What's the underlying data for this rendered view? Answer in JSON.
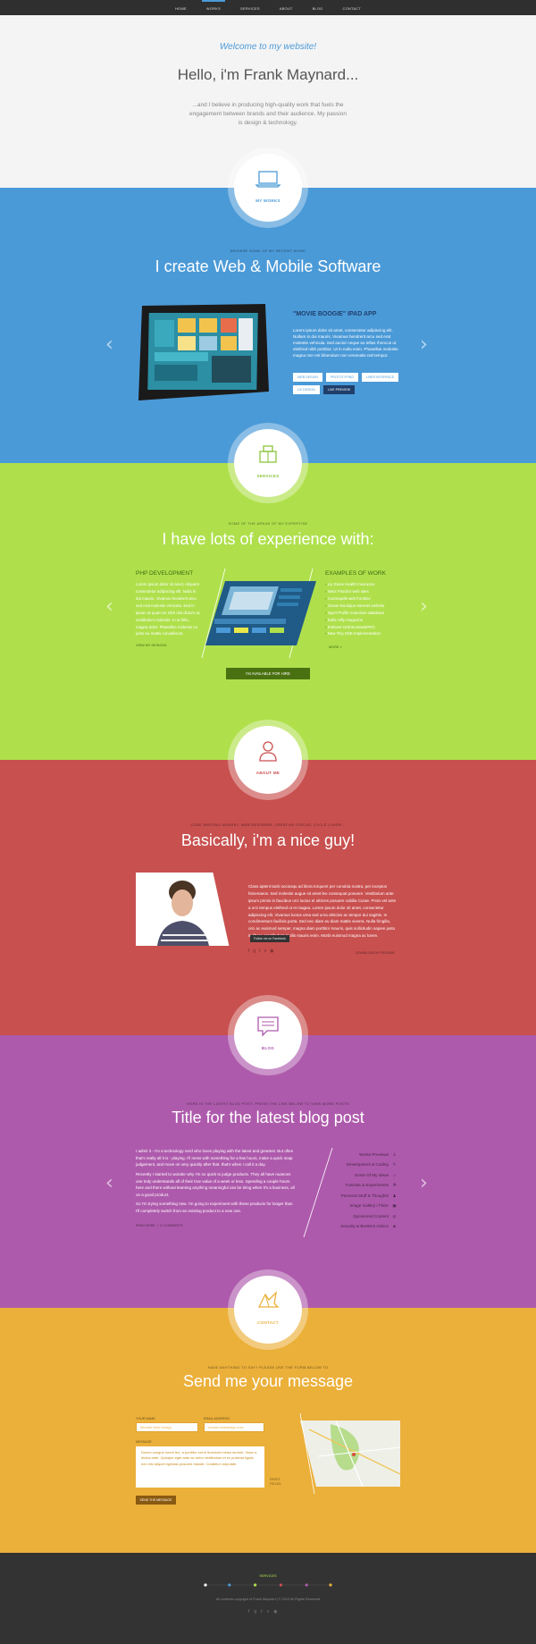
{
  "nav": {
    "items": [
      "HOME",
      "WORKS",
      "SERVICES",
      "ABOUT",
      "BLOG",
      "CONTACT"
    ],
    "active": "WORKS"
  },
  "hero": {
    "welcome": "Welcome to my website!",
    "hello": "Hello, i'm Frank Maynard...",
    "intro": "...and I believe in producing high-quality work that fuels the engagement between brands and their audience. My passion is design & technology."
  },
  "works": {
    "badge": "MY WORKS",
    "kicker": "BROWSE SOME OF MY RECENT WORK",
    "title": "I create Web & Mobile Software",
    "project_title": "\"MOVIE BOOGIE\" IPAD APP",
    "project_text": "Lorem ipsum dolor sit amet, consectetur adipiscing elit. Nullam in dui mauris. Vivamus hendrerit arcu sed erat molestie vehicula. Sed auctor neque eu tellus rhoncus ut eleifend nibh porttitor. Ut in nulla enim. Phasellus molestie magna non est bibendum non venenatis nisl tempor.",
    "tags": [
      "WEB DESIGN",
      "PROTOTYPING",
      "USER INTERFACE",
      "UX DESIGN"
    ],
    "live_preview": "LIVE PREVIEW"
  },
  "services": {
    "badge": "SERVICES",
    "kicker": "SOME OF THE AREAS OF MY EXPERTISE",
    "title": "I have lots of experience with:",
    "left_title": "PHP DEVELOPMENT",
    "left_text": "Lorem ipsum dolor sit amet, Aliquam consectetur adipiscing elit. Nulla in dui mauris. Vivamus hendrerit arcu sed erat molestie vehicula. Sed in ipsum at quam ac nibh nisi dictum ac vestibulum molestie. In ut felis, magna dolor. Phasellus molestie eu justo eu mattis convalliscar.",
    "left_link": "VIEW MY DESIGNS",
    "right_title": "EXAMPLES OF WORK",
    "examples": [
      "Liy Stone Health Insurance",
      "Netix Fiscolor web sites",
      "Cosmopolit web frontline",
      "Ocean Boutique Internet website",
      "Sport Profile extension database",
      "Dolls Hilly magazine",
      "Entisent Gdd BootasisPRO",
      "New Tiny GbE Implementation"
    ],
    "right_link": "MORE »",
    "hire": "I'M AVAILABLE FOR HIRE"
  },
  "about": {
    "badge": "ABOUT ME",
    "kicker": "CODE WRITING MONKEY, WEB DESIGNER, CREATIVE CIRCUS, CYCLE LOVER...",
    "title": "Basically, i'm a nice guy!",
    "text": "Class aptent taciti sociosqu ad litora torquent per conubia nostra, per inceptos himenaeos. Sed molestie augue sit amet leo consequat posuere. Vestibulum ante ipsum primis in faucibus orci luctus et ultrices posuere cubilia Curae. Proin vel ante a orci tempus eleifend ut et magna. Lorem ipsum dolor sit amet, consectetur adipiscing elit. Vivamus luctus urna sed urna ultricies ac tempor dui sagittis. In condimentum facilisis porta. Sed nec diam eu diam mattis viverra. Nulla fringilla, orci ac euismod semper, magna diam porttitor mauris, quis sollicitudin sapien justo in libero. Vestibulum mollis mauris enim. Morbi euismod magna ac lorem.",
    "tooltip": "Follow me on Facebook",
    "download": "DOWNLOAD MY RESUME"
  },
  "blog": {
    "badge": "BLOG",
    "kicker": "HERE IS THE LATEST BLOG POST. PRESS THE LINK BELOW TO VIEW MORE POSTS",
    "title": "Title for the latest blog post",
    "paragraphs": [
      "I admit it - I'm a technology nerd who loves playing with the latest and greatest. But often that's really all it is - playing. I'll mess with something for a few hours, make a quick snap judgement, and move on very quickly after that. that's when I call it a day.",
      "Recently I started to wonder why I'm so quick to judge products. They all have nuances one truly understands all of their true value of a week or less. Spending a couple hours here and there without learning anything meaningful can be tiring when it's a business, all on a good product.",
      "So I'm trying something new. I'm going to experiment with these products for longer than I'll completely switch from an existing product to a new one."
    ],
    "read_more": "READ MORE",
    "comments": "12 COMMENTS",
    "categories": [
      {
        "label": "Works Previews",
        "icon": "person-icon",
        "glyph": "♙"
      },
      {
        "label": "Development & Coding",
        "icon": "wrench-icon",
        "glyph": "✎"
      },
      {
        "label": "Some Of My Ideas",
        "icon": "bulb-icon",
        "glyph": "☼"
      },
      {
        "label": "Tutorials & Experiments",
        "icon": "flask-icon",
        "glyph": "⚗"
      },
      {
        "label": "Personal Stuff & Thoughts",
        "icon": "user-icon",
        "glyph": "♟"
      },
      {
        "label": "Image Gallery / Flickr",
        "icon": "image-icon",
        "glyph": "▣"
      },
      {
        "label": "Sponsored Content",
        "icon": "coin-icon",
        "glyph": "◎"
      },
      {
        "label": "Security & Bonkers Advice",
        "icon": "shield-icon",
        "glyph": "◈"
      }
    ]
  },
  "contact": {
    "badge": "CONTACT",
    "kicker": "HAVE ANYTHING TO SAY? PLEASE USE THE FORM BELOW TO",
    "title": "Send me your message",
    "name_label": "YOUR NAME",
    "name_value": "Wonder Web Design",
    "email_label": "EMAIL ADDRESS",
    "email_value": "wonder.webdesign.com",
    "message_label": "MESSAGE",
    "message_value": "Donec congue lorem leo, a porttitor est in tincidunt metus laoreet. Nunc a lectus ante. Quisque eget ante ac tortor vestibulum et ex pulvinar ligula non nisi aliquet egestas posuere blandit. Curabitur vulputate.",
    "reset": "RESET FIELDS",
    "send": "SEND THE MESSAGE"
  },
  "footer": {
    "services": "SERVICES",
    "copyright": "All contents copyright of Frank Maynard  |  © 2013 All Rights Reserved",
    "dots": [
      "#ffffff",
      "#4b9ad8",
      "#afe04c",
      "#c8504f",
      "#ae5aac",
      "#ebb03a"
    ]
  },
  "social": [
    "facebook-icon",
    "google-plus-icon",
    "twitter-icon",
    "vimeo-icon",
    "dribbble-icon"
  ]
}
